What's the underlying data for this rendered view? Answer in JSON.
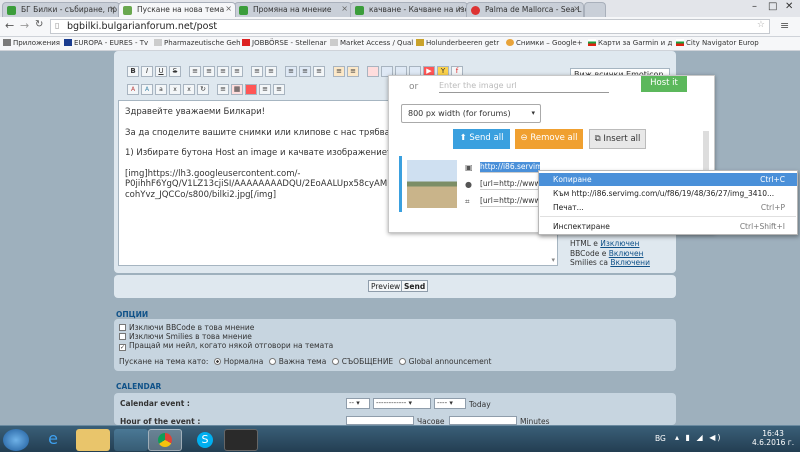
{
  "browser": {
    "tabs": [
      {
        "label": "БГ Билки - събиране, пр"
      },
      {
        "label": "Пускане на нова тема",
        "active": true
      },
      {
        "label": "Промяна на мнение"
      },
      {
        "label": "качване - Качване на изо"
      },
      {
        "label": "Palma de Mallorca - Sea L"
      }
    ],
    "url": "bgbilki.bulgarianforum.net/post",
    "bookmarks": [
      "Приложения",
      "EUROPA - EURES - Tv",
      "Pharmazeutische Geh",
      "JOBBÖRSE - Stellenar",
      "Market Access / Qual",
      "Holunderbeeren getr",
      "Снимки – Google+",
      "Карти за Garmin и д",
      "City Navigator Europ"
    ]
  },
  "editor": {
    "buttons": [
      "B",
      "I",
      "U",
      "S",
      "≡",
      "≡",
      "≡",
      "≡",
      "≡",
      "≡",
      "≡",
      "≡",
      "≡",
      "≡",
      "≡",
      "▶",
      "Y",
      "f",
      "≡"
    ],
    "emoticons_label": "Виж всички Emoticon",
    "lines": [
      "Здравейте уважаеми Билкари!",
      "За да споделите вашите снимки или клипове с нас трябва да сла",
      "1) Избирате бутона Host an image и качвате изображението на с",
      "[img]https://lh3.googleusercontent.com/-",
      "P0jihhF6YgQ/V1LZ13cjiSI/AAAAAAAADQU/2EoAALUpx58cyAMUHX",
      "cohYvz_JQCCo/s800/bilki2.jpg[/img]"
    ],
    "bbcode_info": {
      "html": "HTML е",
      "html_state": "Изключен",
      "bbcode": "BBCode е",
      "bbcode_state": "Включен",
      "smilies": "Smilies са",
      "smilies_state": "Включени"
    }
  },
  "send_bar": {
    "preview": "Preview",
    "send": "Send"
  },
  "options": {
    "title": "ОПЦИИ",
    "items": [
      {
        "label": "Изключи BBCode в това мнение",
        "checked": false
      },
      {
        "label": "Изключи Smilies в това мнение",
        "checked": false
      },
      {
        "label": "Пращай ми нейл, когато някой отговори на темата",
        "checked": true
      }
    ],
    "post_as_label": "Пускане на тема като:",
    "post_types": [
      {
        "label": "Нормална",
        "selected": true
      },
      {
        "label": "Важна тема",
        "selected": false
      },
      {
        "label": "СЪОБЩЕНИЕ",
        "selected": false
      },
      {
        "label": "Global announcement",
        "selected": false
      }
    ]
  },
  "calendar": {
    "title": "CALENDAR",
    "event_label": "Calendar event :",
    "day": "--",
    "month": "------------",
    "year": "----",
    "today": "Today",
    "hour_label": "Hour of the event :",
    "hours_label": "Часове",
    "minutes_label": "Minutes"
  },
  "upload": {
    "or_label": "or",
    "url_placeholder": "Enter the image url",
    "host_button": "Host it",
    "size_option": "800 px width (for forums)",
    "send_all": "Send all",
    "remove_all": "Remove all",
    "insert_all": "Insert all",
    "links": [
      "http://i86.servimg.com/u/f86/19/48/36/27/img_3410.jpg",
      "[url=http://www.servimg.com/view/19483627/6",
      "[url=http://www.servimg.com/view/19483627/6"
    ]
  },
  "context_menu": {
    "items": [
      {
        "label": "Копиране",
        "shortcut": "Ctrl+C",
        "highlighted": true
      },
      {
        "label": "Към http://i86.servimg.com/u/f86/19/48/36/27/img_3410...",
        "shortcut": ""
      },
      {
        "label": "Печат...",
        "shortcut": "Ctrl+P"
      },
      {
        "label": "Инспектиране",
        "shortcut": "Ctrl+Shift+I"
      }
    ]
  },
  "taskbar": {
    "lang": "BG",
    "time": "16:43",
    "date": "4.6.2016 г."
  },
  "colors": {
    "accent": "#105289",
    "send_all": "#3aa0df",
    "remove_all": "#f0a030",
    "highlight": "#4a90d9"
  }
}
